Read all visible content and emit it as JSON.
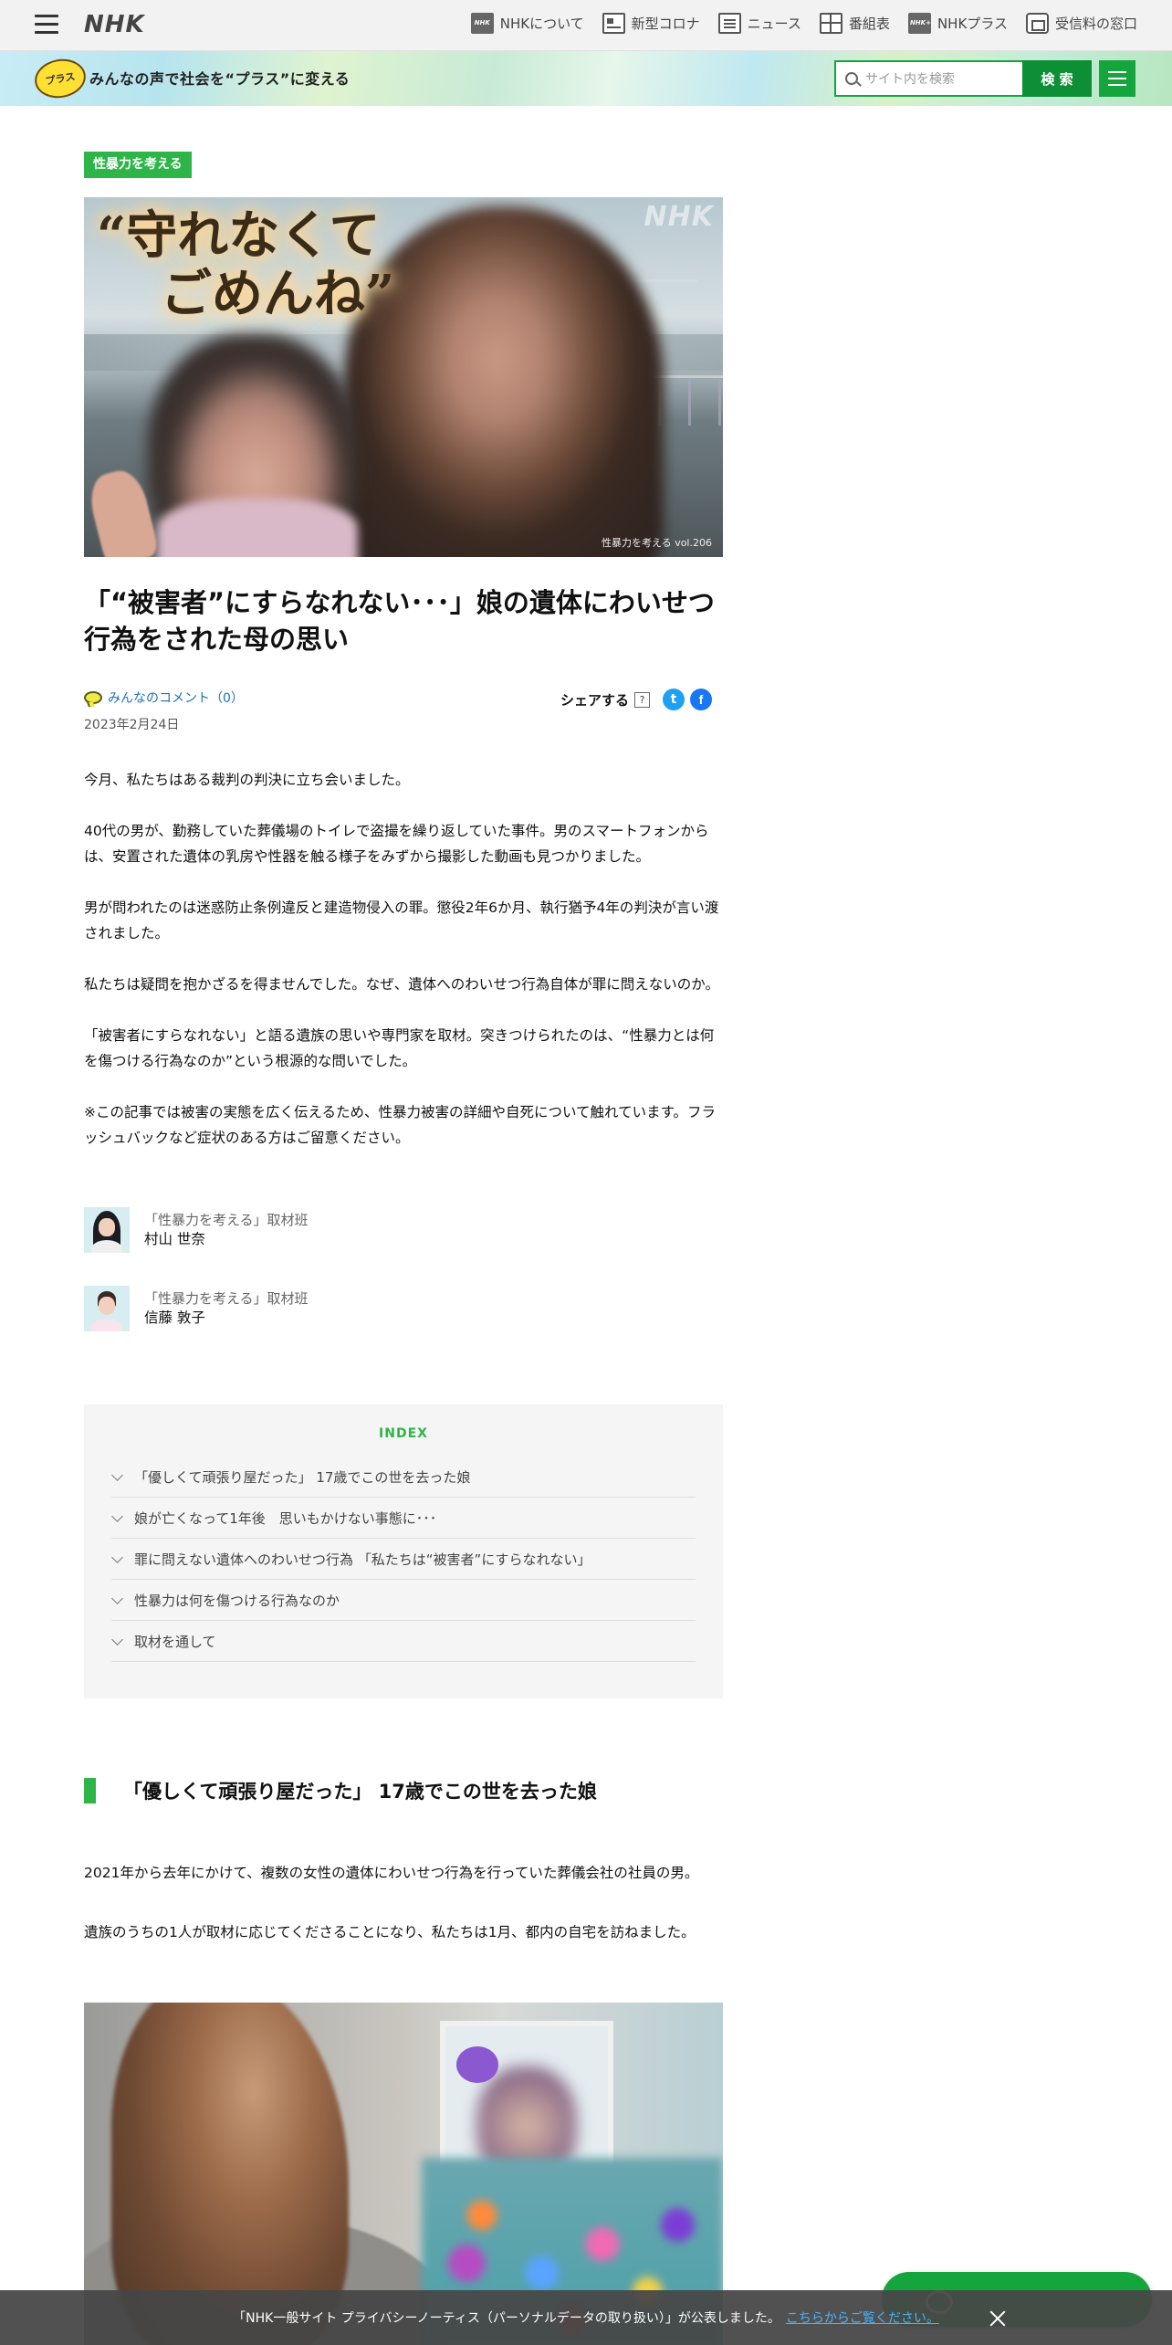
{
  "header": {
    "logo": "NHK",
    "nav": [
      {
        "label": "NHKについて",
        "icon": "nhk-icon"
      },
      {
        "label": "新型コロナ",
        "icon": "corona-icon"
      },
      {
        "label": "ニュース",
        "icon": "news-icon"
      },
      {
        "label": "番組表",
        "icon": "program-guide-icon"
      },
      {
        "label": "NHKプラス",
        "icon": "nhk-plus-icon"
      },
      {
        "label": "受信料の窓口",
        "icon": "license-fee-icon"
      }
    ]
  },
  "banner": {
    "logo_text": "プラス",
    "tagline": "みんなの声で社会を“プラス”に変える",
    "search_placeholder": "サイト内を検索",
    "search_button": "検 索"
  },
  "article": {
    "category": "性暴力を考える",
    "hero": {
      "quote_line1": "“守れなくて",
      "quote_line2": "ごめんね”",
      "watermark": "NHK",
      "caption": "性暴力を考える vol.206"
    },
    "title": "「“被害者”にすらなれない･･･」娘の遺体にわいせつ行為をされた母の思い",
    "comments_label": "みんなのコメント（0）",
    "date": "2023年2月24日",
    "share_label": "シェアする",
    "share_help": "?",
    "lead": [
      "今月、私たちはある裁判の判決に立ち会いました。",
      "40代の男が、勤務していた葬儀場のトイレで盗撮を繰り返していた事件。男のスマートフォンからは、安置された遺体の乳房や性器を触る様子をみずから撮影した動画も見つかりました。",
      "男が問われたのは迷惑防止条例違反と建造物侵入の罪。懲役2年6か月、執行猶予4年の判決が言い渡されました。",
      "私たちは疑問を抱かざるを得ませんでした。なぜ、遺体へのわいせつ行為自体が罪に問えないのか。",
      "「被害者にすらなれない」と語る遺族の思いや専門家を取材。突きつけられたのは、“性暴力とは何を傷つける行為なのか”という根源的な問いでした。",
      "※この記事では被害の実態を広く伝えるため、性暴力被害の詳細や自死について触れています。フラッシュバックなど症状のある方はご留意ください。"
    ],
    "authors": [
      {
        "team": "「性暴力を考える」取材班",
        "name": "村山 世奈"
      },
      {
        "team": "「性暴力を考える」取材班",
        "name": "信藤 敦子"
      }
    ],
    "index": {
      "title": "INDEX",
      "items": [
        "「優しくて頑張り屋だった」 17歳でこの世を去った娘",
        "娘が亡くなって1年後　思いもかけない事態に･･･",
        "罪に問えない遺体へのわいせつ行為 「私たちは“被害者”にすらなれない」",
        "性暴力は何を傷つける行為なのか",
        "取材を通して"
      ]
    },
    "section1": {
      "heading": "「優しくて頑張り屋だった」 17歳でこの世を去った娘",
      "paragraphs": [
        "2021年から去年にかけて、複数の女性の遺体にわいせつ行為を行っていた葬儀会社の社員の男。",
        "遺族のうちの1人が取材に応じてくださることになり、私たちは1月、都内の自宅を訪ねました。"
      ]
    }
  },
  "privacy": {
    "text": "「NHK一般サイト プライバシーノーティス（パーソナルデータの取り扱い）」が公表しました。",
    "link": "こちらからご覧ください。"
  }
}
